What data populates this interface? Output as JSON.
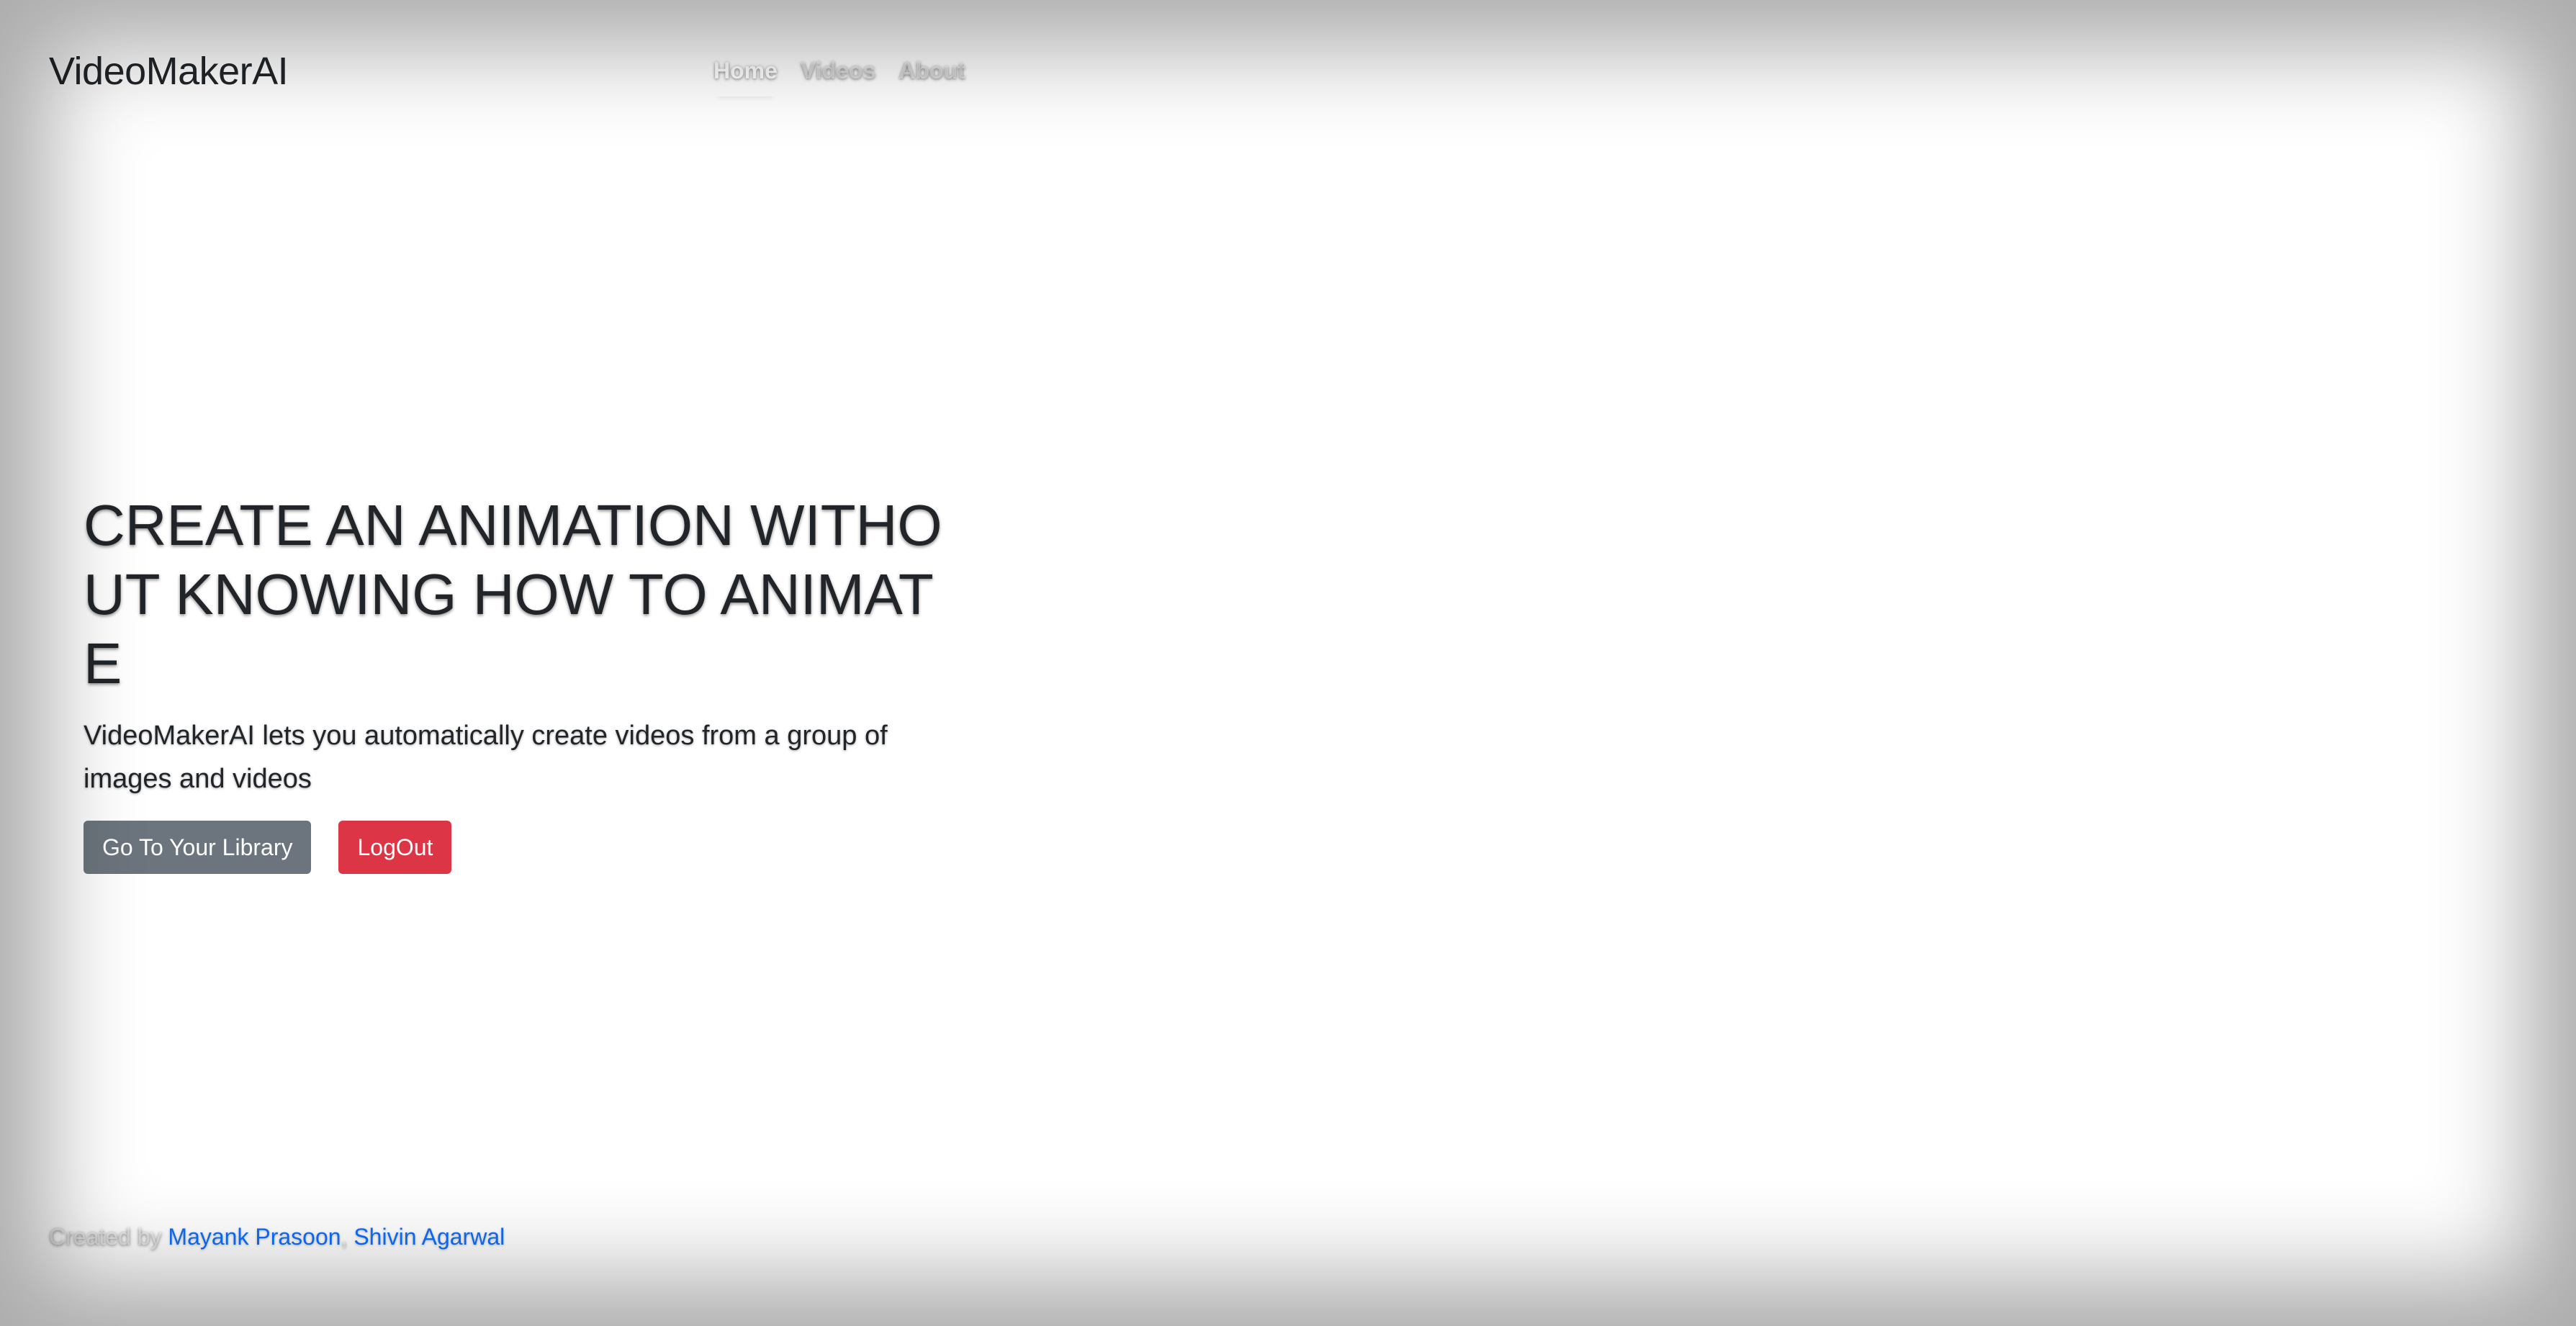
{
  "header": {
    "brand": "VideoMakerAI",
    "nav": [
      {
        "label": "Home",
        "active": true
      },
      {
        "label": "Videos",
        "active": false
      },
      {
        "label": "About",
        "active": false
      }
    ]
  },
  "hero": {
    "title": "CREATE AN ANIMATION WITHOUT KNOWING HOW TO ANIMATE",
    "lead": "VideoMakerAI lets you automatically create videos from a group of images and videos",
    "library_button": "Go To Your Library",
    "logout_button": "LogOut"
  },
  "footer": {
    "created_by": "Created by",
    "authors": [
      "Mayank Prasoon",
      "Shivin Agarwal"
    ],
    "separator": ","
  },
  "colors": {
    "secondary_button": "#6c757d",
    "danger_button": "#dc3545",
    "link": "#0d6efd",
    "text": "#212529"
  }
}
